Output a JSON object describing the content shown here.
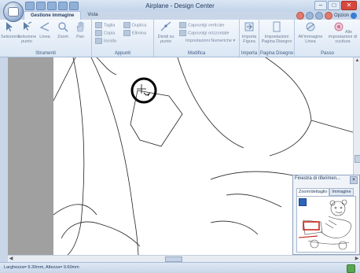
{
  "app": {
    "title": "Airplane - Design Center",
    "tabs": [
      "Gestione immagine",
      "Vista"
    ],
    "options_label": "Opzion",
    "window_buttons": {
      "minimize": "–",
      "restore": "□",
      "close": "✕"
    }
  },
  "ribbon": {
    "groups": [
      {
        "label": "Strumenti",
        "buttons": [
          "Seleziona",
          "Selezione punto",
          "Linea",
          "Zoom",
          "Pan"
        ]
      },
      {
        "label": "Appunti",
        "buttons": [
          "Taglia",
          "Duplica",
          "Copia",
          "Elimina",
          "Incolla"
        ]
      },
      {
        "label": "Modifica",
        "buttons": [
          "Dividi su punto",
          "Capovolgi verticale",
          "Capovolgi orizzontale",
          "Impostazioni Numeriche"
        ]
      },
      {
        "label": "Importa",
        "buttons": [
          "Importa Figura"
        ]
      },
      {
        "label": "Pagina Disegno",
        "buttons": [
          "Impostazioni Pagina Disegno"
        ]
      },
      {
        "label": "Passo",
        "buttons": [
          "All'immagine Linea",
          "Alle impostazioni di cucitura"
        ]
      }
    ]
  },
  "reference_panel": {
    "title": "Finestra di riferimen...",
    "tabs": [
      "Zoom/dettaglio",
      "Immagine"
    ],
    "close": "×"
  },
  "status": {
    "text": "Larghezza= 9.30mm, Altezza= 9.60mm"
  },
  "colors": {
    "accent": "#2c64b8",
    "title_text": "#1e395b",
    "close_button": "#d8473b",
    "highlight_rect": "#cc2a1f"
  }
}
